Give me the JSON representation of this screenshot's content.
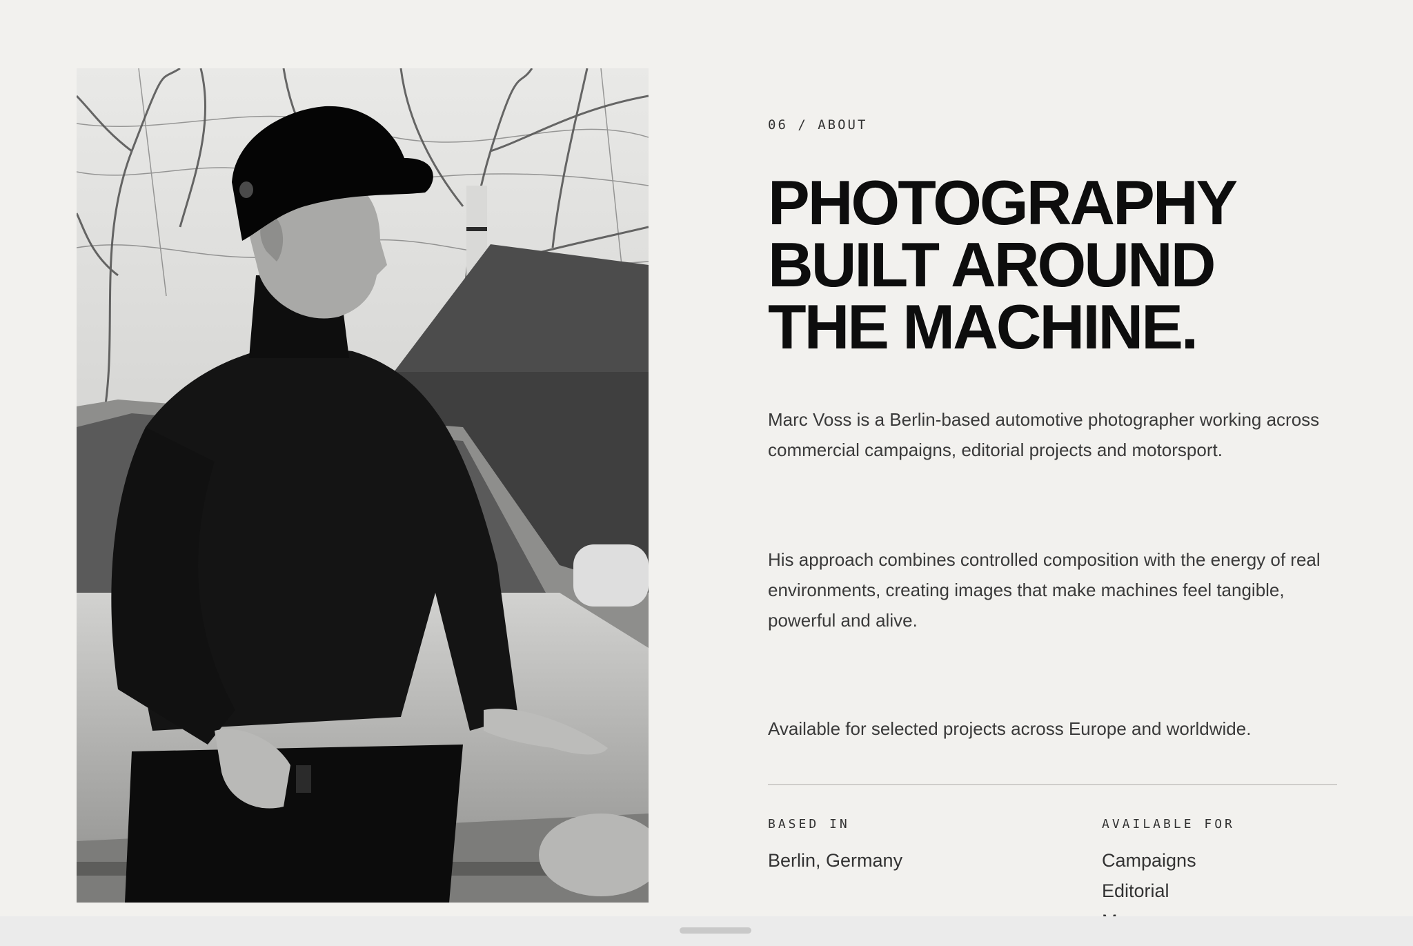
{
  "photo": {
    "description_icon": "portrait-photo"
  },
  "about": {
    "eyebrow": "06 / ABOUT",
    "headline": "PHOTOGRAPHY\nBUILT AROUND\nTHE MACHINE.",
    "paragraph_1": "Marc Voss is a Berlin-based automotive photographer working across commercial campaigns, editorial projects and motorsport.",
    "paragraph_2": "His approach combines controlled composition with the energy of real environments, creating images that make machines feel tangible, powerful and alive.",
    "paragraph_3": "Available for selected projects across Europe and worldwide."
  },
  "info": {
    "based_in_label": "BASED IN",
    "based_in_value": "Berlin, Germany",
    "available_for_label": "AVAILABLE FOR",
    "available_for_items": [
      "Campaigns",
      "Editorial",
      "M"
    ]
  },
  "colors": {
    "background": "#f2f1ee",
    "headline": "#0d0d0d",
    "body_text": "#3a3a3a",
    "divider": "#cfcdca"
  }
}
